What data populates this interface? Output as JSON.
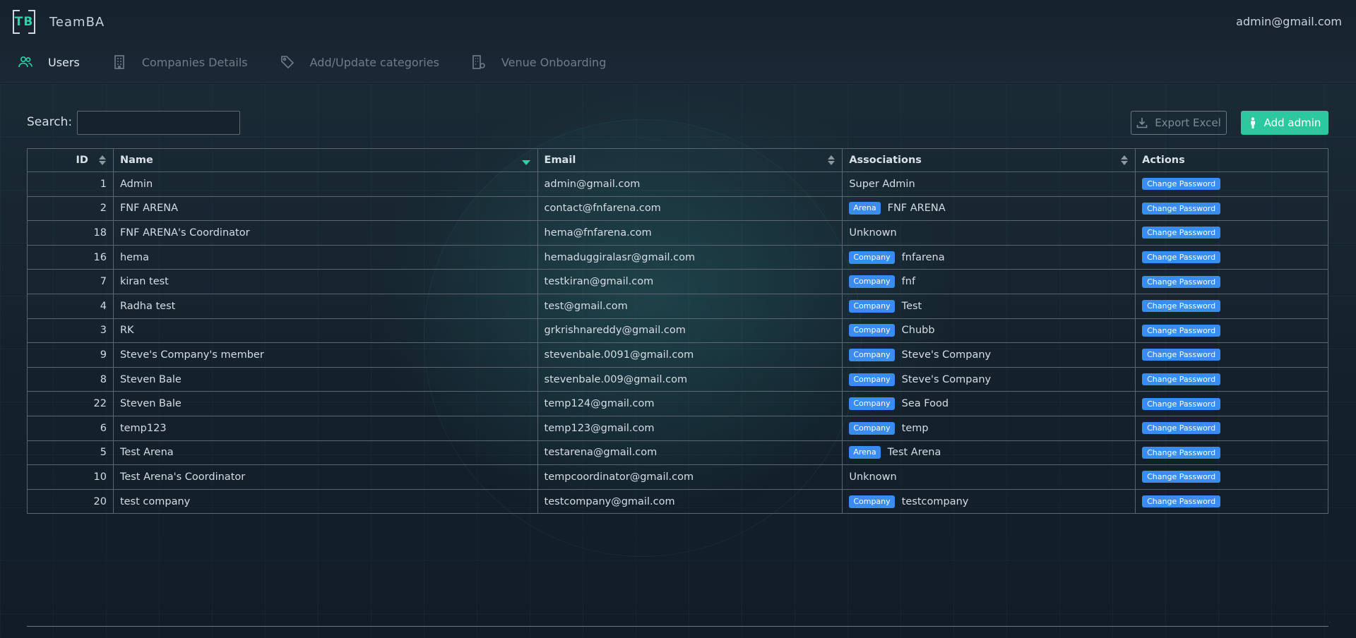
{
  "app": {
    "logo": "TB",
    "name": "TeamBA",
    "user_email": "admin@gmail.com"
  },
  "nav": [
    {
      "label": "Users",
      "icon": "users-icon",
      "active": true
    },
    {
      "label": "Companies Details",
      "icon": "building-icon",
      "active": false
    },
    {
      "label": "Add/Update categories",
      "icon": "tag-icon",
      "active": false
    },
    {
      "label": "Venue Onboarding",
      "icon": "building-gear-icon",
      "active": false
    }
  ],
  "toolbar": {
    "search_label": "Search:",
    "search_value": "",
    "export_label": "Export Excel",
    "add_label": "Add admin"
  },
  "table": {
    "columns": [
      "ID",
      "Name",
      "Email",
      "Associations",
      "Actions"
    ],
    "action_label": "Change Password",
    "rows": [
      {
        "id": "1",
        "name": "Admin",
        "email": "admin@gmail.com",
        "badge": "",
        "association": "Super Admin"
      },
      {
        "id": "2",
        "name": "FNF ARENA",
        "email": "contact@fnfarena.com",
        "badge": "Arena",
        "association": "FNF ARENA"
      },
      {
        "id": "18",
        "name": "FNF ARENA's Coordinator",
        "email": "hema@fnfarena.com",
        "badge": "",
        "association": "Unknown"
      },
      {
        "id": "16",
        "name": "hema",
        "email": "hemaduggiralasr@gmail.com",
        "badge": "Company",
        "association": "fnfarena"
      },
      {
        "id": "7",
        "name": "kiran test",
        "email": "testkiran@gmail.com",
        "badge": "Company",
        "association": "fnf"
      },
      {
        "id": "4",
        "name": "Radha test",
        "email": "test@gmail.com",
        "badge": "Company",
        "association": "Test"
      },
      {
        "id": "3",
        "name": "RK",
        "email": "grkrishnareddy@gmail.com",
        "badge": "Company",
        "association": "Chubb"
      },
      {
        "id": "9",
        "name": "Steve's Company's member",
        "email": "stevenbale.0091@gmail.com",
        "badge": "Company",
        "association": "Steve's Company"
      },
      {
        "id": "8",
        "name": "Steven Bale",
        "email": "stevenbale.009@gmail.com",
        "badge": "Company",
        "association": "Steve's Company"
      },
      {
        "id": "22",
        "name": "Steven Bale",
        "email": "temp124@gmail.com",
        "badge": "Company",
        "association": "Sea Food"
      },
      {
        "id": "6",
        "name": "temp123",
        "email": "temp123@gmail.com",
        "badge": "Company",
        "association": "temp"
      },
      {
        "id": "5",
        "name": "Test Arena",
        "email": "testarena@gmail.com",
        "badge": "Arena",
        "association": "Test Arena"
      },
      {
        "id": "10",
        "name": "Test Arena's Coordinator",
        "email": "tempcoordinator@gmail.com",
        "badge": "",
        "association": "Unknown"
      },
      {
        "id": "20",
        "name": "test company",
        "email": "testcompany@gmail.com",
        "badge": "Company",
        "association": "testcompany"
      }
    ]
  },
  "colors": {
    "accent": "#2cc9a0",
    "badge": "#3a8df0",
    "background": "#14212c"
  }
}
